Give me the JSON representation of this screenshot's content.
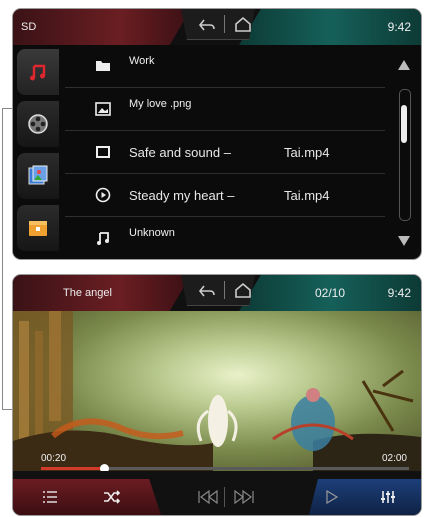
{
  "browser": {
    "source": "SD",
    "clock": "9:42",
    "categories": [
      {
        "name": "music-icon"
      },
      {
        "name": "film-reel-icon"
      },
      {
        "name": "picture-icon"
      },
      {
        "name": "folder-icon"
      }
    ],
    "files": [
      {
        "icon": "folder-icon",
        "name": "Work",
        "ext": ""
      },
      {
        "icon": "image-file-icon",
        "name": "My love .png",
        "ext": ""
      },
      {
        "icon": "video-file-icon",
        "name": "Safe and sound –",
        "ext": "Tai.mp4"
      },
      {
        "icon": "play-circle-icon",
        "name": "Steady my heart –",
        "ext": "Tai.mp4"
      },
      {
        "icon": "music-note-icon",
        "name": "Unknown",
        "ext": ""
      }
    ],
    "scroll_position": 0.15
  },
  "player": {
    "title": "The angel",
    "track_counter": "02/10",
    "clock": "9:42",
    "elapsed": "00:20",
    "total": "02:00",
    "progress": 0.17,
    "controls": [
      "list-icon",
      "shuffle-icon",
      "previous-icon",
      "next-icon",
      "play-icon",
      "equalizer-icon"
    ]
  },
  "colors": {
    "accent_red": "#6a1e22",
    "accent_teal": "#16605a",
    "accent_blue": "#1d3f7a",
    "progress": "#d23a2a"
  }
}
